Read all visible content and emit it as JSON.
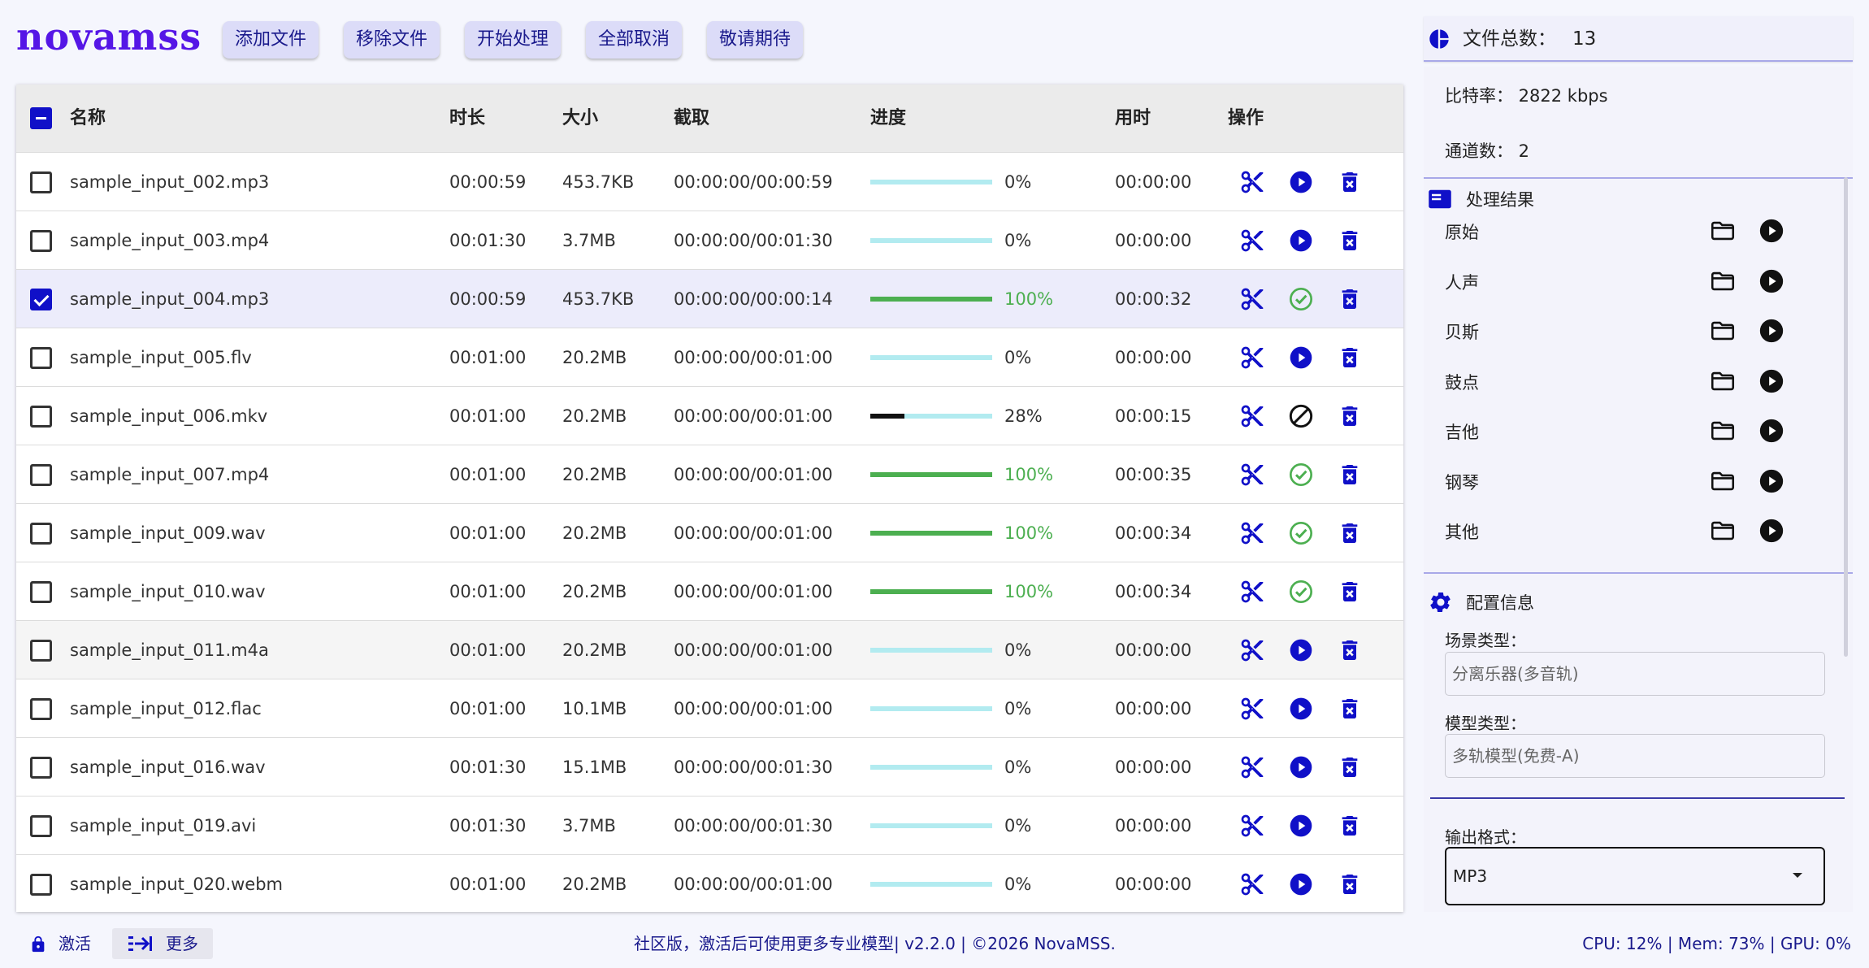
{
  "app": {
    "logo": "novamss"
  },
  "toolbar": {
    "add": "添加文件",
    "remove": "移除文件",
    "start": "开始处理",
    "cancel_all": "全部取消",
    "coming": "敬请期待"
  },
  "table": {
    "headers": {
      "name": "名称",
      "duration": "时长",
      "size": "大小",
      "clip": "截取",
      "progress": "进度",
      "elapsed": "用时",
      "actions": "操作"
    },
    "rows": [
      {
        "name": "sample_input_002.mp3",
        "duration": "00:00:59",
        "size": "453.7KB",
        "clip": "00:00:00/00:00:59",
        "progress": 0,
        "progress_text": "0%",
        "elapsed": "00:00:00",
        "checked": false,
        "status": "play"
      },
      {
        "name": "sample_input_003.mp4",
        "duration": "00:01:30",
        "size": "3.7MB",
        "clip": "00:00:00/00:01:30",
        "progress": 0,
        "progress_text": "0%",
        "elapsed": "00:00:00",
        "checked": false,
        "status": "play"
      },
      {
        "name": "sample_input_004.mp3",
        "duration": "00:00:59",
        "size": "453.7KB",
        "clip": "00:00:00/00:00:14",
        "progress": 100,
        "progress_text": "100%",
        "elapsed": "00:00:32",
        "checked": true,
        "status": "done"
      },
      {
        "name": "sample_input_005.flv",
        "duration": "00:01:00",
        "size": "20.2MB",
        "clip": "00:00:00/00:01:00",
        "progress": 0,
        "progress_text": "0%",
        "elapsed": "00:00:00",
        "checked": false,
        "status": "play"
      },
      {
        "name": "sample_input_006.mkv",
        "duration": "00:01:00",
        "size": "20.2MB",
        "clip": "00:00:00/00:01:00",
        "progress": 28,
        "progress_text": "28%",
        "elapsed": "00:00:15",
        "checked": false,
        "status": "running"
      },
      {
        "name": "sample_input_007.mp4",
        "duration": "00:01:00",
        "size": "20.2MB",
        "clip": "00:00:00/00:01:00",
        "progress": 100,
        "progress_text": "100%",
        "elapsed": "00:00:35",
        "checked": false,
        "status": "done"
      },
      {
        "name": "sample_input_009.wav",
        "duration": "00:01:00",
        "size": "20.2MB",
        "clip": "00:00:00/00:01:00",
        "progress": 100,
        "progress_text": "100%",
        "elapsed": "00:00:34",
        "checked": false,
        "status": "done"
      },
      {
        "name": "sample_input_010.wav",
        "duration": "00:01:00",
        "size": "20.2MB",
        "clip": "00:00:00/00:01:00",
        "progress": 100,
        "progress_text": "100%",
        "elapsed": "00:00:34",
        "checked": false,
        "status": "done"
      },
      {
        "name": "sample_input_011.m4a",
        "duration": "00:01:00",
        "size": "20.2MB",
        "clip": "00:00:00/00:01:00",
        "progress": 0,
        "progress_text": "0%",
        "elapsed": "00:00:00",
        "checked": false,
        "status": "play",
        "hover": true
      },
      {
        "name": "sample_input_012.flac",
        "duration": "00:01:00",
        "size": "10.1MB",
        "clip": "00:00:00/00:01:00",
        "progress": 0,
        "progress_text": "0%",
        "elapsed": "00:00:00",
        "checked": false,
        "status": "play"
      },
      {
        "name": "sample_input_016.wav",
        "duration": "00:01:30",
        "size": "15.1MB",
        "clip": "00:00:00/00:01:30",
        "progress": 0,
        "progress_text": "0%",
        "elapsed": "00:00:00",
        "checked": false,
        "status": "play"
      },
      {
        "name": "sample_input_019.avi",
        "duration": "00:01:30",
        "size": "3.7MB",
        "clip": "00:00:00/00:01:30",
        "progress": 0,
        "progress_text": "0%",
        "elapsed": "00:00:00",
        "checked": false,
        "status": "play"
      },
      {
        "name": "sample_input_020.webm",
        "duration": "00:01:00",
        "size": "20.2MB",
        "clip": "00:00:00/00:01:00",
        "progress": 0,
        "progress_text": "0%",
        "elapsed": "00:00:00",
        "checked": false,
        "status": "play"
      }
    ]
  },
  "panel": {
    "file_count_label": "文件总数：",
    "file_count": "13",
    "bitrate": "比特率：  2822 kbps",
    "channels": "通道数：  2",
    "results_title": "处理结果",
    "results": [
      "原始",
      "人声",
      "贝斯",
      "鼓点",
      "吉他",
      "钢琴",
      "其他"
    ],
    "config_title": "配置信息",
    "scene_label": "场景类型：",
    "scene_value": "分离乐器(多音轨)",
    "model_label": "模型类型：",
    "model_value": "多轨模型(免费-A)",
    "format_label": "输出格式：",
    "format_value": "MP3"
  },
  "footer": {
    "activate": "激活",
    "more": "更多",
    "notice": "社区版，激活后可使用更多专业模型| v2.2.0 | ©2026 NovaMSS.",
    "stats": "CPU: 12% | Mem: 73% | GPU: 0%"
  },
  "colors": {
    "accent": "#1010c8",
    "brand": "#5516e6",
    "success": "#4caf50",
    "track": "#b2ebf0"
  }
}
